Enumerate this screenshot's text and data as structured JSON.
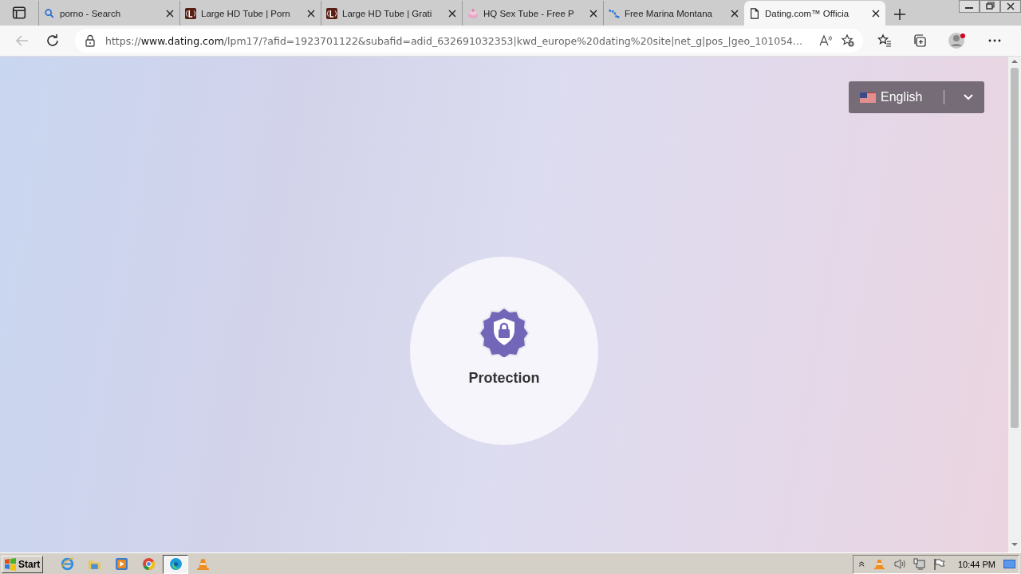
{
  "tabs": [
    {
      "title": "porno - Search",
      "kind": "search",
      "selected": false
    },
    {
      "title": "Large HD Tube | Porn",
      "kind": "letter",
      "selected": false
    },
    {
      "title": "Large HD Tube | Grati",
      "kind": "letter",
      "selected": false
    },
    {
      "title": "HQ Sex Tube - Free P",
      "kind": "cake",
      "selected": false
    },
    {
      "title": "Free Marina Montana",
      "kind": "dots",
      "selected": false
    },
    {
      "title": "Dating.com™ Officia",
      "kind": "page",
      "selected": true
    }
  ],
  "address_bar": {
    "scheme": "https://",
    "host": "www.dating.com",
    "path": "/lpm17/?afid=1923701122&subafid=adid_632691032353|kwd_europe%20dating%20site|net_g|pos_|geo_101054..."
  },
  "language_select": {
    "value": "English"
  },
  "feature": {
    "label": "Protection"
  },
  "taskbar": {
    "start": "Start",
    "apps": [
      {
        "kind": "ie",
        "selected": false
      },
      {
        "kind": "folder",
        "selected": false
      },
      {
        "kind": "media",
        "selected": false
      },
      {
        "kind": "chrome",
        "selected": false
      },
      {
        "kind": "edge",
        "selected": true
      },
      {
        "kind": "vlc",
        "selected": false
      }
    ],
    "clock": "10:44 PM"
  }
}
